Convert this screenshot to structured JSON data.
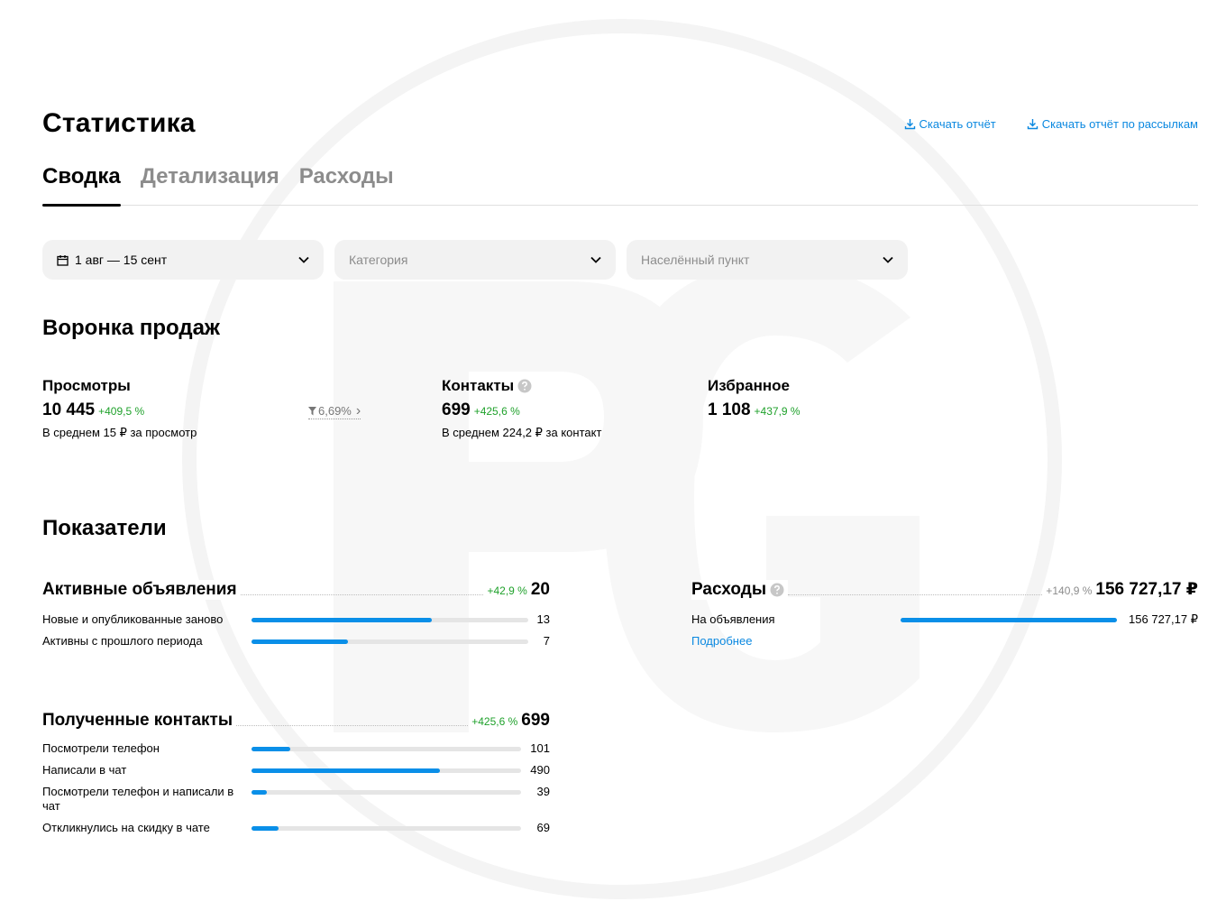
{
  "page": {
    "title": "Статистика",
    "downloads": [
      {
        "label": "Скачать отчёт"
      },
      {
        "label": "Скачать отчёт по рассылкам"
      }
    ],
    "tabs": [
      {
        "label": "Сводка",
        "active": true
      },
      {
        "label": "Детализация",
        "active": false
      },
      {
        "label": "Расходы",
        "active": false
      }
    ],
    "filters": {
      "date": {
        "value": "1 авг — 15 сент"
      },
      "category": {
        "placeholder": "Категория"
      },
      "locality": {
        "placeholder": "Населённый пункт"
      }
    }
  },
  "funnel": {
    "title": "Воронка продаж",
    "views": {
      "label": "Просмотры",
      "value": "10 445",
      "growth": "+409,5 %",
      "sub": "В среднем 15 ₽ за просмотр"
    },
    "conversion": {
      "value": "6,69%",
      "symbol": "›"
    },
    "contacts": {
      "label": "Контакты",
      "value": "699",
      "growth": "+425,6 %",
      "sub": "В среднем 224,2 ₽ за контакт"
    },
    "favorites": {
      "label": "Избранное",
      "value": "1 108",
      "growth": "+437,9 %"
    }
  },
  "indicators": {
    "title": "Показатели",
    "active_ads": {
      "name": "Активные объявления",
      "growth": "+42,9 %",
      "total": "20",
      "rows": [
        {
          "label": "Новые и опубликованные заново",
          "value": "13",
          "fill": 0.65
        },
        {
          "label": "Активны с прошлого периода",
          "value": "7",
          "fill": 0.35
        }
      ]
    },
    "contacts": {
      "name": "Полученные контакты",
      "growth": "+425,6 %",
      "total": "699",
      "rows": [
        {
          "label": "Посмотрели телефон",
          "value": "101",
          "fill": 0.144
        },
        {
          "label": "Написали в чат",
          "value": "490",
          "fill": 0.7
        },
        {
          "label": "Посмотрели телефон и написали в чат",
          "value": "39",
          "fill": 0.056
        },
        {
          "label": "Откликнулись на скидку в чате",
          "value": "69",
          "fill": 0.099
        }
      ]
    },
    "expenses": {
      "name": "Расходы",
      "growth": "+140,9 %",
      "total": "156 727,17 ₽",
      "rows": [
        {
          "label": "На объявления",
          "value": "156 727,17 ₽",
          "fill": 1.0
        }
      ],
      "more_label": "Подробнее"
    }
  },
  "colors": {
    "accent_blue": "#0a8fe8",
    "link_blue": "#0a88e0",
    "growth_green": "#1fa12b",
    "muted_grey": "#8c8c8c",
    "filter_bg": "#f2f2f2"
  }
}
